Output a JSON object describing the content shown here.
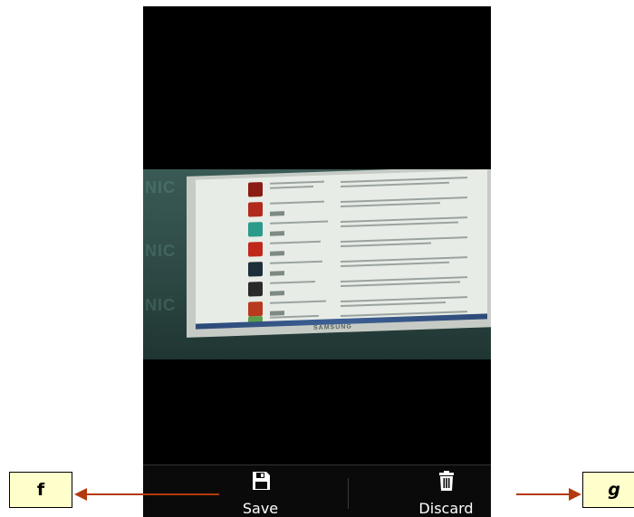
{
  "actions": {
    "save": {
      "label": "Save",
      "icon": "save-icon"
    },
    "discard": {
      "label": "Discard",
      "icon": "trash-icon"
    }
  },
  "photo": {
    "monitor_brand": "SAMSUNG"
  },
  "annotations": {
    "left_tag": "f",
    "right_tag": "g"
  },
  "colors": {
    "arrow": "#b33a0e",
    "tag_background": "#ffffcc",
    "action_bar": "#0a0a0a"
  }
}
